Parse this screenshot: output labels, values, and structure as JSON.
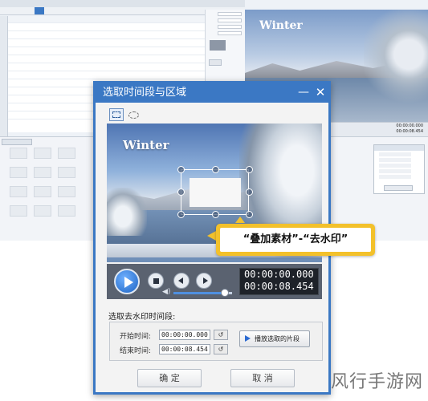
{
  "background_app": {
    "video_title": "Winter",
    "time_lines": [
      "00:00:00.000",
      "00:00:08.454"
    ]
  },
  "dialog": {
    "title": "选取时间段与区域",
    "minimize_glyph": "—",
    "close_glyph": "✕",
    "preview_title": "Winter",
    "player": {
      "current_time": "00:00:00.000",
      "total_time": "00:00:08.454",
      "seek_progress": 1.0,
      "volume_level": 0.88
    },
    "range": {
      "section_label": "选取去水印时间段:",
      "start_label": "开始时间:",
      "start_value": "00:00:00.000",
      "end_label": "结束时间:",
      "end_value": "00:00:08.454",
      "reset_glyph": "↺",
      "play_clip_label": "播放选取的片段"
    },
    "ok_label": "确 定",
    "cancel_label": "取 消"
  },
  "callout": {
    "text": "“叠加素材”-“去水印”"
  },
  "watermark": {
    "text": "风行手游网"
  },
  "icons": {
    "rect_select": "rectangle-select-icon",
    "ellipse_select": "ellipse-select-icon",
    "play": "play-icon",
    "stop": "stop-icon",
    "prev": "previous-icon",
    "next": "next-icon",
    "volume": "volume-icon"
  },
  "colors": {
    "accent": "#3b78c4",
    "callout": "#f3c12b",
    "control_bar": "#5a6270"
  }
}
